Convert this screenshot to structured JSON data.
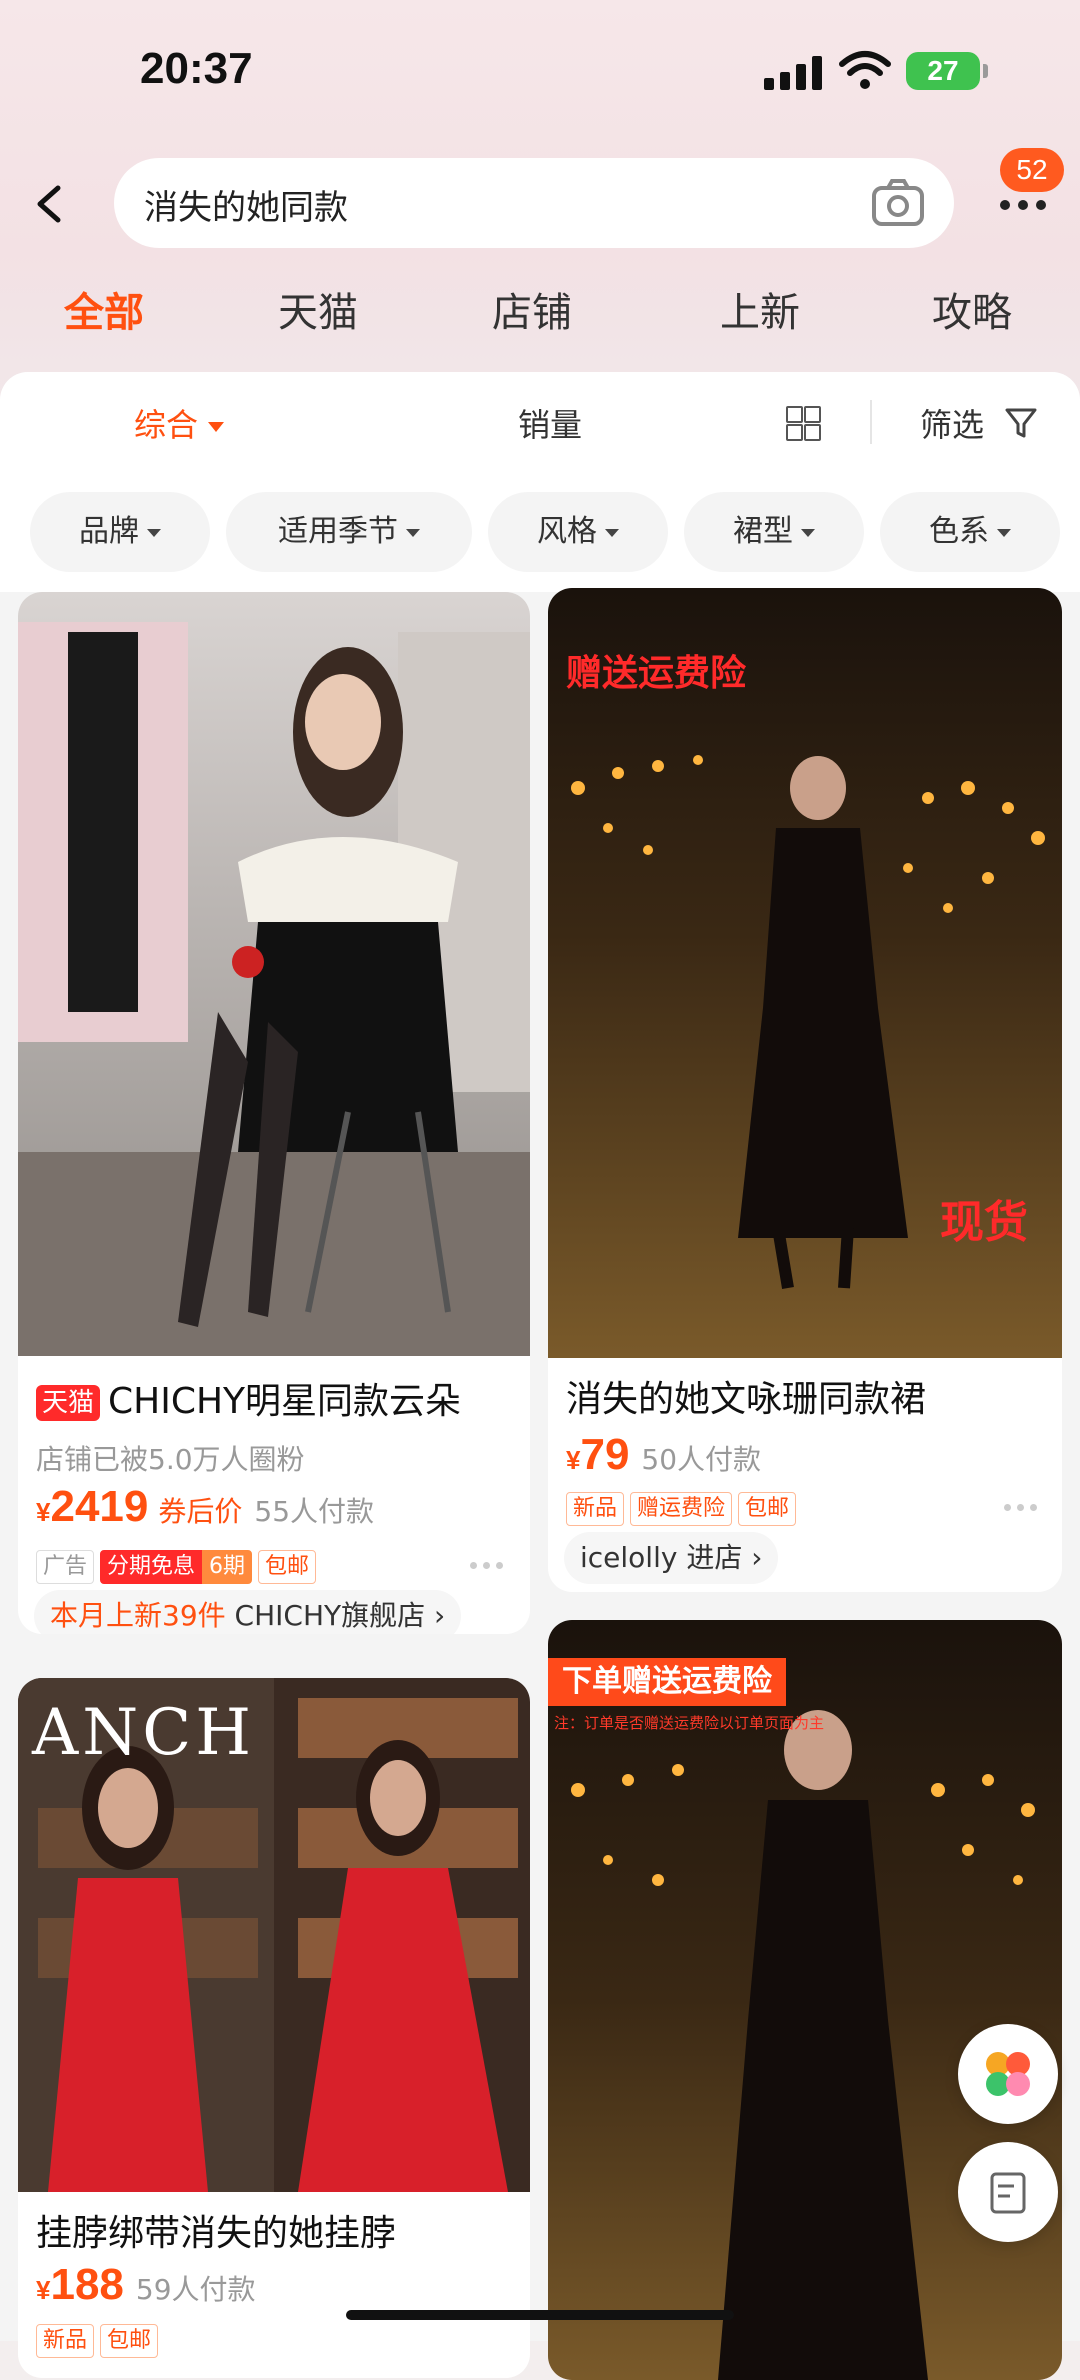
{
  "status_bar": {
    "time": "20:37",
    "battery": "27"
  },
  "search": {
    "query": "消失的她同款",
    "message_count": "52"
  },
  "category_tabs": [
    {
      "label": "全部",
      "active": true
    },
    {
      "label": "天猫",
      "active": false
    },
    {
      "label": "店铺",
      "active": false
    },
    {
      "label": "上新",
      "active": false
    },
    {
      "label": "攻略",
      "active": false
    }
  ],
  "sort_bar": {
    "comprehensive": "综合",
    "sales": "销量",
    "filter": "筛选"
  },
  "filter_chips": [
    "品牌",
    "适用季节",
    "风格",
    "裙型",
    "色系"
  ],
  "products": [
    {
      "platform_tag": "天猫",
      "title": "CHICHY明星同款云朵",
      "subtitle": "店铺已被5.0万人圈粉",
      "price": "2419",
      "price_note": "券后价",
      "paid": "55人付款",
      "tags": [
        "广告",
        "分期免息",
        "6期",
        "包邮"
      ],
      "shop_line_highlight": "本月上新39件",
      "shop_name": "CHICHY旗舰店"
    },
    {
      "title": "消失的她文咏珊同款裙",
      "price": "79",
      "paid": "50人付款",
      "tags": [
        "新品",
        "赠运费险",
        "包邮"
      ],
      "shop_name": "icelolly",
      "shop_action": "进店",
      "image_overlay_top": "赠送运费险",
      "image_overlay_bottom": "现货"
    },
    {
      "title": "挂脖绑带消失的她挂脖",
      "price": "188",
      "paid": "59人付款",
      "tags": [
        "新品",
        "包邮"
      ],
      "image_overlay": "ANCH"
    },
    {
      "image_overlay_top": "下单赠送运费险",
      "image_overlay_note": "注：订单是否赠送运费险以订单页面为主"
    }
  ],
  "currency": "¥"
}
